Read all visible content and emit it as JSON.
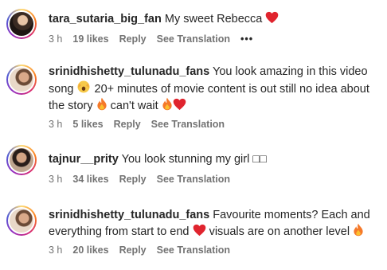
{
  "comments": [
    {
      "username": "tara_sutaria_big_fan",
      "text_parts": [
        "My sweet Rebecca"
      ],
      "time": "3 h",
      "likes": "19 likes",
      "reply": "Reply",
      "see_translation": "See Translation",
      "more": "•••"
    },
    {
      "username": "srinidhishetty_tulunadu_fans",
      "text_parts": [
        "You look amazing in this video song",
        "20+ minutes of movie content is out still no idea about the story",
        "can't wait"
      ],
      "time": "3 h",
      "likes": "5 likes",
      "reply": "Reply",
      "see_translation": "See Translation"
    },
    {
      "username": "tajnur__prity",
      "text_parts": [
        "You look stunning my girl □□"
      ],
      "time": "3 h",
      "likes": "34 likes",
      "reply": "Reply",
      "see_translation": "See Translation"
    },
    {
      "username": "srinidhishetty_tulunadu_fans",
      "text_parts": [
        "Favourite moments? Each and everything from start to end",
        "visuals are on another level"
      ],
      "time": "3 h",
      "likes": "20 likes",
      "reply": "Reply",
      "see_translation": "See Translation"
    }
  ],
  "icons": {
    "heart": "red-heart-icon",
    "fire": "fire-icon",
    "hands": "hands-face-icon"
  },
  "colors": {
    "heart": "#e0242e",
    "fire": "#f5792a",
    "meta": "#737373",
    "text": "#262626"
  }
}
